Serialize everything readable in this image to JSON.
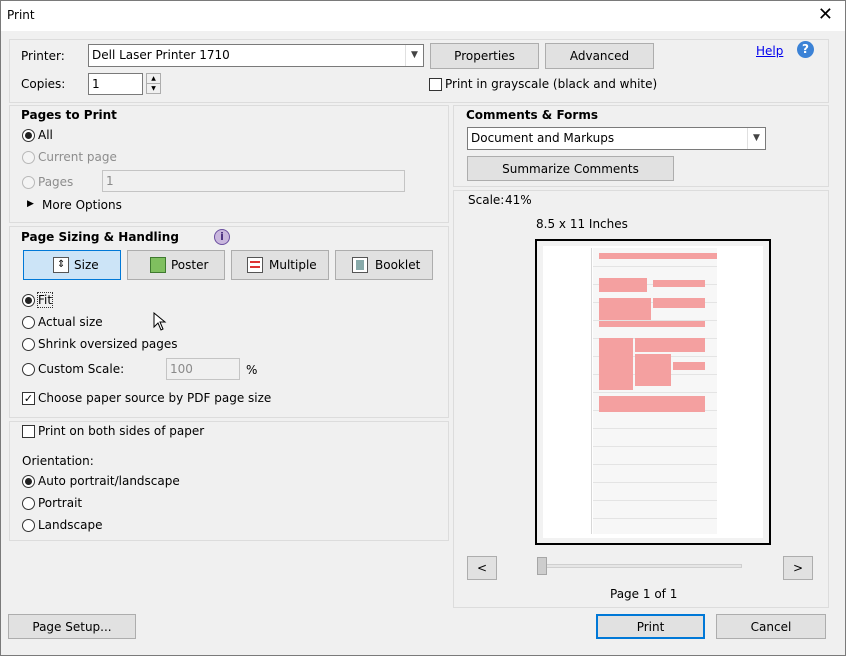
{
  "dialog": {
    "title": "Print",
    "close_glyph": "✕"
  },
  "printer": {
    "printer_label": "Printer:",
    "printer_value": "Dell Laser Printer 1710",
    "properties_label": "Properties",
    "advanced_label": "Advanced",
    "help_label": "Help",
    "help_glyph": "?",
    "copies_label": "Copies:",
    "copies_value": "1",
    "grayscale_label": "Print in grayscale (black and white)"
  },
  "pages_to_print": {
    "heading": "Pages to Print",
    "all_label": "All",
    "current_label": "Current page",
    "pages_label": "Pages",
    "pages_value": "1",
    "more_options_label": "More Options"
  },
  "page_sizing": {
    "heading": "Page Sizing & Handling",
    "info_glyph": "i",
    "buttons": {
      "size": "Size",
      "poster": "Poster",
      "multiple": "Multiple",
      "booklet": "Booklet"
    },
    "fit_label": "Fit",
    "actual_label": "Actual size",
    "shrink_label": "Shrink oversized pages",
    "custom_label": "Custom Scale:",
    "custom_value": "100",
    "percent": "%",
    "paper_source_label": "Choose paper source by PDF page size"
  },
  "duplex": {
    "both_sides_label": "Print on both sides of paper",
    "orientation_label": "Orientation:",
    "auto_label": "Auto portrait/landscape",
    "portrait_label": "Portrait",
    "landscape_label": "Landscape"
  },
  "comments": {
    "heading": "Comments & Forms",
    "select_value": "Document and Markups",
    "summarize_label": "Summarize Comments"
  },
  "preview": {
    "scale_label": "Scale:",
    "scale_value": "41%",
    "paper_size": "8.5 x 11 Inches",
    "prev_glyph": "<",
    "next_glyph": ">",
    "page_indicator": "Page 1 of 1"
  },
  "footer": {
    "page_setup_label": "Page Setup...",
    "print_label": "Print",
    "cancel_label": "Cancel"
  },
  "colors": {
    "accent": "#0078d7",
    "preview_markup": "#f4a0a0"
  }
}
